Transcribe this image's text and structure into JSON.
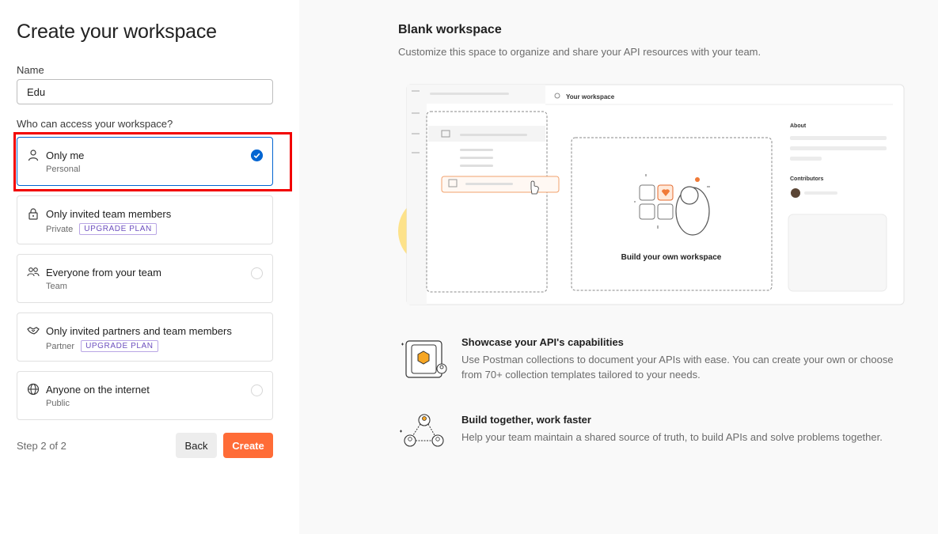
{
  "form": {
    "title": "Create your workspace",
    "name_label": "Name",
    "name_value": "Edu",
    "access_label": "Who can access your workspace?",
    "options": [
      {
        "title": "Only me",
        "subtitle": "Personal",
        "badge": "",
        "selected": true,
        "icon": "person-icon"
      },
      {
        "title": "Only invited team members",
        "subtitle": "Private",
        "badge": "UPGRADE PLAN",
        "selected": false,
        "icon": "lock-icon"
      },
      {
        "title": "Everyone from your team",
        "subtitle": "Team",
        "badge": "",
        "selected": false,
        "icon": "team-icon"
      },
      {
        "title": "Only invited partners and team members",
        "subtitle": "Partner",
        "badge": "UPGRADE PLAN",
        "selected": false,
        "icon": "handshake-icon"
      },
      {
        "title": "Anyone on the internet",
        "subtitle": "Public",
        "badge": "",
        "selected": false,
        "icon": "globe-icon"
      }
    ],
    "step": "Step 2 of 2",
    "back_label": "Back",
    "create_label": "Create"
  },
  "preview": {
    "title": "Blank workspace",
    "description": "Customize this space to organize and share your API resources with your team.",
    "mock": {
      "workspace_label": "Your workspace",
      "center_label": "Build your own workspace",
      "about_label": "About",
      "contributors_label": "Contributors"
    },
    "features": [
      {
        "title": "Showcase your API's capabilities",
        "description": "Use Postman collections to document your APIs with ease. You can create your own or choose from 70+ collection templates tailored to your needs.",
        "icon": "collection-card-icon"
      },
      {
        "title": "Build together, work faster",
        "description": "Help your team maintain a shared source of truth, to build APIs and solve problems together.",
        "icon": "team-network-icon"
      }
    ]
  },
  "colors": {
    "accent": "#ff6c37",
    "selected": "#0265d2",
    "highlight": "#f20000",
    "badge": "#6d4fbf"
  }
}
